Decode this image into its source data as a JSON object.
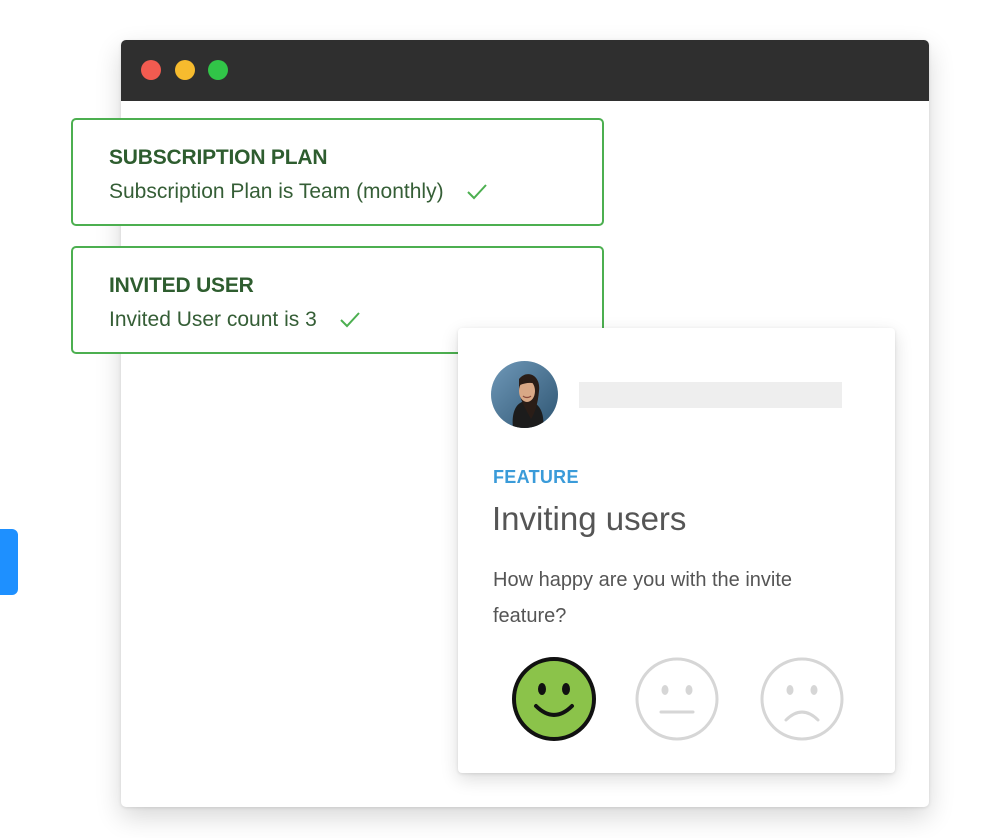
{
  "window": {
    "traffic_lights": {
      "close_color": "#f25b50",
      "minimize_color": "#f6bb2e",
      "maximize_color": "#31c548"
    }
  },
  "conditions": [
    {
      "title": "SUBSCRIPTION PLAN",
      "text": "Subscription Plan is Team (monthly)",
      "icon": "check-icon",
      "status_color": "#4caf50"
    },
    {
      "title": "INVITED USER",
      "text": "Invited User count is 3",
      "icon": "check-icon",
      "status_color": "#4caf50"
    }
  ],
  "survey": {
    "avatar_icon": "user-avatar",
    "tag": "FEATURE",
    "title": "Inviting users",
    "question": "How happy are you with the invite feature?",
    "options": [
      {
        "icon": "happy-face-icon",
        "selected": true,
        "color": "#8bc34a"
      },
      {
        "icon": "neutral-face-icon",
        "selected": false,
        "color": "#d6d6d6"
      },
      {
        "icon": "sad-face-icon",
        "selected": false,
        "color": "#d6d6d6"
      }
    ],
    "accent_color": "#3a9bd9"
  },
  "side_tab": {
    "color": "#1e90ff"
  }
}
